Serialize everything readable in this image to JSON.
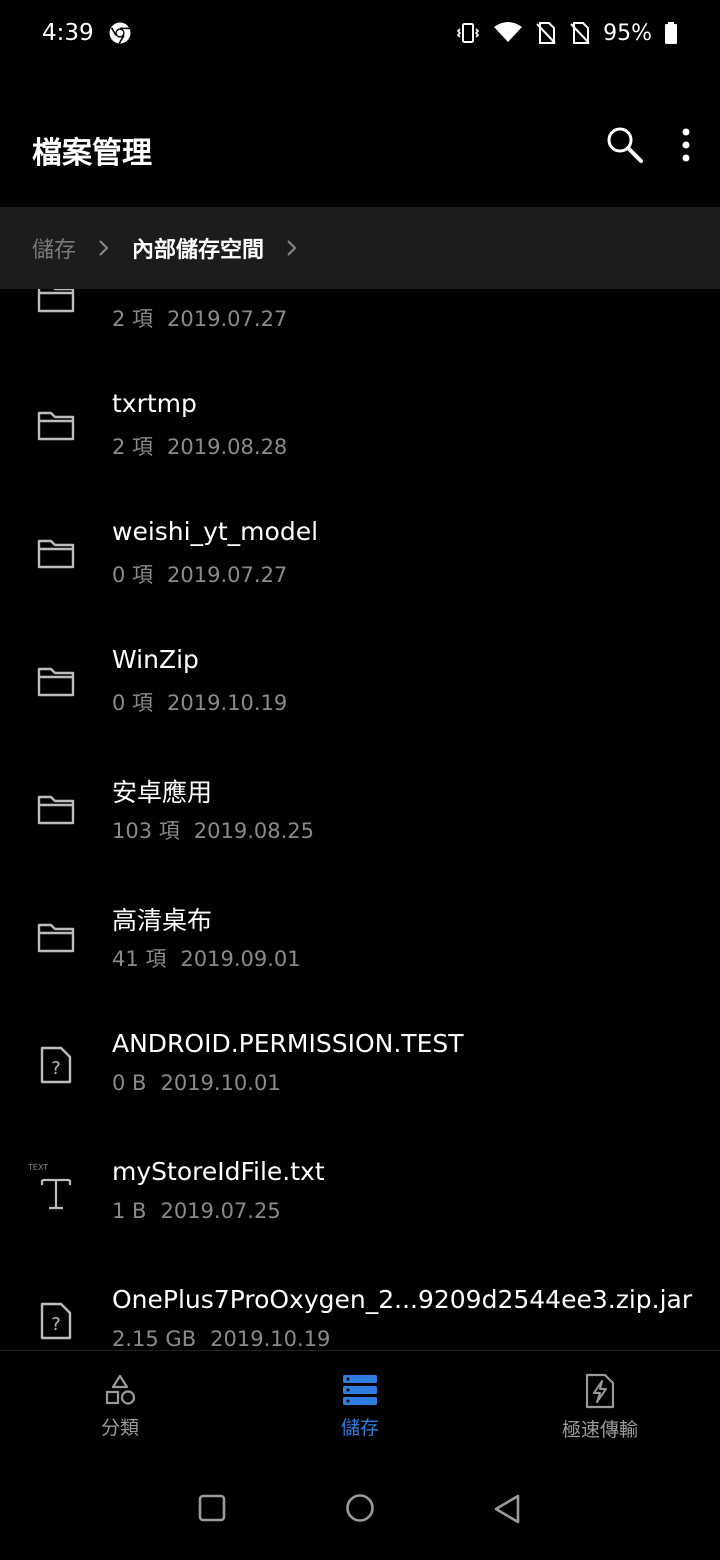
{
  "status_bar": {
    "time": "4:39",
    "battery_percent": "95%"
  },
  "header": {
    "title": "檔案管理"
  },
  "breadcrumb": {
    "root": "儲存",
    "current": "內部儲存空間"
  },
  "files": [
    {
      "type": "folder",
      "name": "",
      "count": "2 項",
      "date": "2019.07.27"
    },
    {
      "type": "folder",
      "name": "txrtmp",
      "count": "2 項",
      "date": "2019.08.28"
    },
    {
      "type": "folder",
      "name": "weishi_yt_model",
      "count": "0 項",
      "date": "2019.07.27"
    },
    {
      "type": "folder",
      "name": "WinZip",
      "count": "0 項",
      "date": "2019.10.19"
    },
    {
      "type": "folder",
      "name": "安卓應用",
      "count": "103 項",
      "date": "2019.08.25"
    },
    {
      "type": "folder",
      "name": "高清桌布",
      "count": "41 項",
      "date": "2019.09.01"
    },
    {
      "type": "unknown",
      "name": "ANDROID.PERMISSION.TEST",
      "count": "0 B",
      "date": "2019.10.01"
    },
    {
      "type": "text",
      "name": "myStoreIdFile.txt",
      "count": "1 B",
      "date": "2019.07.25",
      "badge": "TEXT"
    },
    {
      "type": "unknown",
      "name": "OnePlus7ProOxygen_2...9209d2544ee3.zip.jar",
      "count": "2.15 GB",
      "date": "2019.10.19"
    }
  ],
  "bottom_nav": {
    "items": [
      {
        "label": "分類",
        "icon": "categories-icon",
        "active": false
      },
      {
        "label": "儲存",
        "icon": "storage-icon",
        "active": true
      },
      {
        "label": "極速傳輸",
        "icon": "fast-transfer-icon",
        "active": false
      }
    ]
  },
  "colors": {
    "accent": "#2f7de1",
    "background": "#000000",
    "breadcrumb_bg": "#1c1c1c",
    "secondary_text": "#8a8a8a"
  }
}
